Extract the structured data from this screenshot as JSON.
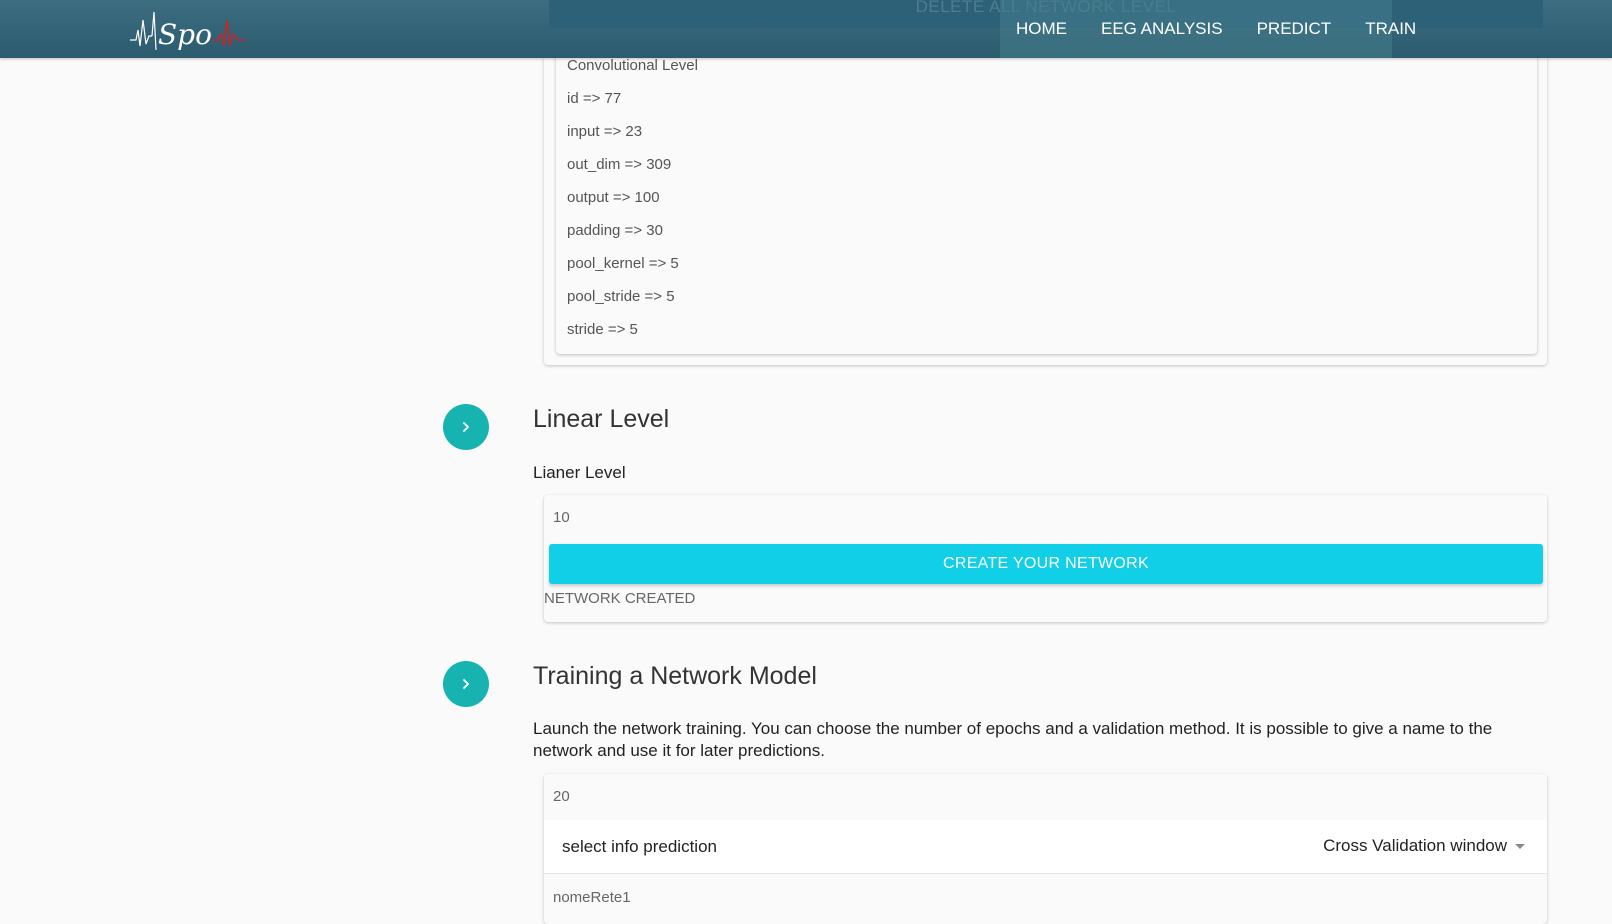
{
  "header": {
    "logo_text": "Spo",
    "ghost_button": "DELETE ALL NETWORK LEVEL",
    "nav": [
      "HOME",
      "EEG ANALYSIS",
      "PREDICT",
      "TRAIN"
    ]
  },
  "conv_level": {
    "title": "Convolutional Level",
    "fields": [
      "id => 77",
      "input => 23",
      "out_dim => 309",
      "output => 100",
      "padding => 30",
      "pool_kernel => 5",
      "pool_stride => 5",
      "stride => 5"
    ]
  },
  "linear_section": {
    "title": "Linear Level",
    "label": "Lianer Level",
    "input_value": "10",
    "button": "CREATE YOUR NETWORK",
    "status": "NETWORK CREATED"
  },
  "training_section": {
    "title": "Training a Network Model",
    "description": "Launch the network training. You can choose the number of epochs and a validation method. It is possible to give a name to the network and use it for later predictions.",
    "epochs_value": "20",
    "select_label": "select info prediction",
    "select_value": "Cross Validation window",
    "network_name_value": "nomeRete1"
  },
  "colors": {
    "header": "#2b5b6e",
    "accent_circle": "#17b3b0",
    "button": "#10cfe6",
    "logo_pulse": "#c0282c"
  },
  "icons": {
    "step": "chevron-right-icon",
    "select": "caret-down-icon"
  }
}
